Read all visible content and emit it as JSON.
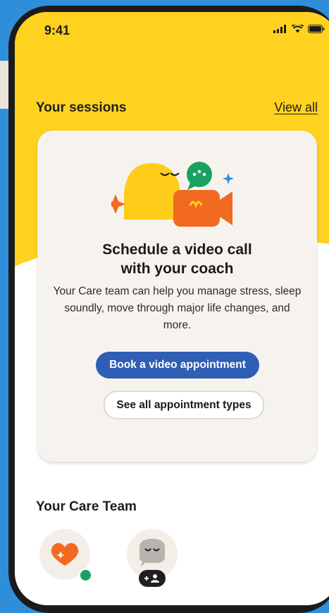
{
  "status_bar": {
    "time": "9:41"
  },
  "sessions": {
    "title": "Your sessions",
    "view_all": "View all",
    "card": {
      "title_line1": "Schedule a video call",
      "title_line2": "with your coach",
      "description": "Your Care team can help you manage stress, sleep soundly, move through major life changes, and more.",
      "primary_button": "Book a video appointment",
      "secondary_button": "See all appointment types"
    }
  },
  "care_team": {
    "title": "Your Care Team",
    "members": [
      {
        "icon": "heart-icon",
        "status": "online"
      },
      {
        "icon": "speech-bubble-face-icon",
        "action": "add-person"
      }
    ]
  },
  "colors": {
    "header_yellow": "#ffd21f",
    "primary_blue": "#2f5eb5",
    "background_blue": "#2f8ed9",
    "online_green": "#1aa160",
    "heart_orange": "#f26a21"
  }
}
